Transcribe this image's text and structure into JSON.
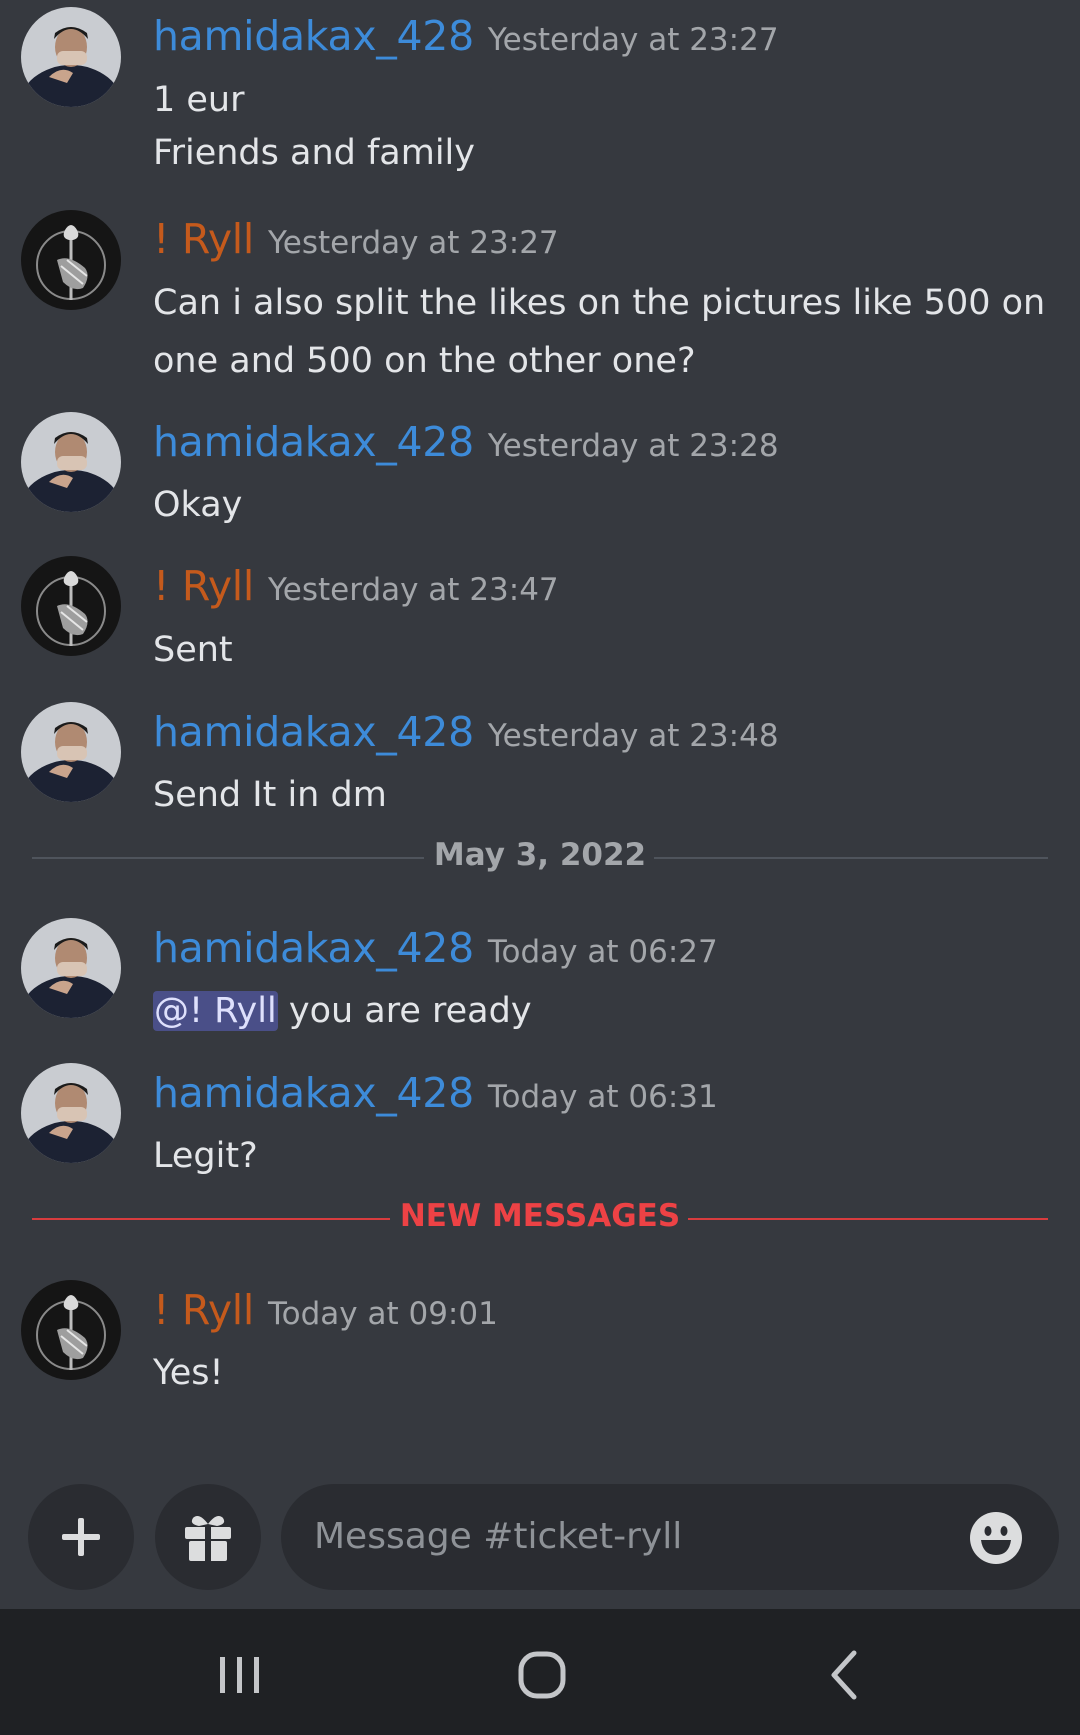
{
  "messages": [
    {
      "user": "hamidakax_428",
      "time": "Yesterday at 23:27",
      "lines": [
        "1 eur",
        "Friends and family"
      ]
    },
    {
      "user": "! Ryll",
      "time": "Yesterday at 23:27",
      "lines": [
        "Can i also split the likes on the pictures like 500 on",
        "one and 500 on the other one?"
      ]
    },
    {
      "user": "hamidakax_428",
      "time": "Yesterday at 23:28",
      "lines": [
        "Okay"
      ]
    },
    {
      "user": "! Ryll",
      "time": "Yesterday at 23:47",
      "lines": [
        "Sent"
      ]
    },
    {
      "user": "hamidakax_428",
      "time": "Yesterday at 23:48",
      "lines": [
        "Send It in dm"
      ]
    },
    {
      "user": "hamidakax_428",
      "time": "Today at 06:27",
      "mention": "@! Ryll",
      "lines": [
        " you are ready"
      ]
    },
    {
      "user": "hamidakax_428",
      "time": "Today at 06:31",
      "lines": [
        "Legit?"
      ]
    },
    {
      "user": "! Ryll",
      "time": "Today at 09:01",
      "lines": [
        "Yes!"
      ]
    }
  ],
  "date_divider": "May 3, 2022",
  "new_messages_divider": "NEW MESSAGES",
  "composer": {
    "placeholder": "Message #ticket-ryll",
    "plus_icon": "plus-icon",
    "gift_icon": "gift-icon",
    "emoji_icon": "emoji-icon"
  },
  "colors": {
    "background": "#36393f",
    "hamid_name": "#3d8bd9",
    "ryll_name": "#c55a1c",
    "new_messages": "#ed4245",
    "mention_bg": "#4a4f88"
  },
  "navbar": {
    "icons": [
      "recent-apps-icon",
      "home-icon",
      "back-icon"
    ]
  }
}
